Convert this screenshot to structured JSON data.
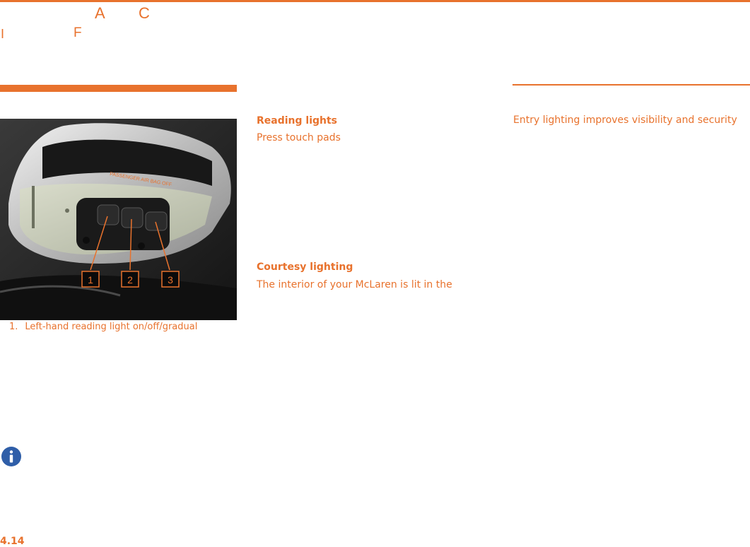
{
  "header": {
    "letters": [
      "A",
      "C",
      "I",
      "F"
    ]
  },
  "figure": {
    "warning_label": "PASSENGER AIR BAG OFF",
    "callouts": [
      "1",
      "2",
      "3"
    ],
    "caption_number": "1.",
    "caption_text": "Left-hand reading light on/off/gradual"
  },
  "reading_lights": {
    "heading": "Reading lights",
    "text": "Press touch pads"
  },
  "courtesy_lighting": {
    "heading": "Courtesy lighting",
    "text": "The interior of your McLaren is lit in the"
  },
  "entry_lighting": {
    "text": "Entry lighting improves visibility and security"
  },
  "page": {
    "number": "4.14"
  },
  "colors": {
    "accent": "#e8722d"
  },
  "icons": [
    "info-icon"
  ]
}
